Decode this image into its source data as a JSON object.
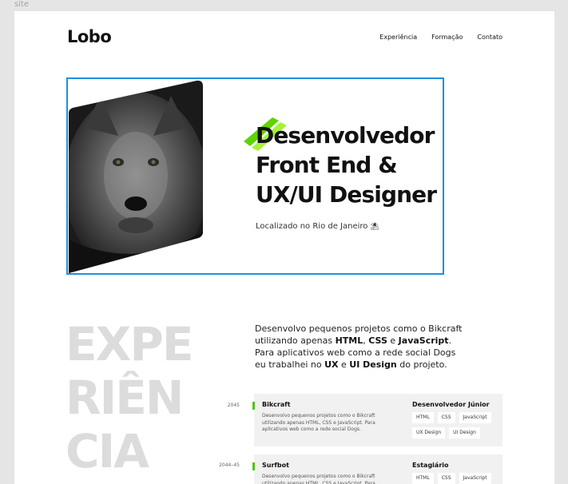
{
  "canvas": {
    "label": "site"
  },
  "header": {
    "logo": "Lobo",
    "nav": [
      "Experiência",
      "Formação",
      "Contato"
    ]
  },
  "hero": {
    "title_lines": [
      "Desenvolvedor",
      "Front End &",
      "UX/UI Designer"
    ],
    "location": "Localizado no Rio de Janeiro",
    "location_icon": "beach-umbrella-icon",
    "accent_color": "#6dd400",
    "selection_color": "#1f8fe0"
  },
  "experience": {
    "heading_lines": [
      "EXPE",
      "RIÊN",
      "CIA"
    ],
    "intro": {
      "p1": "Desenvolvo pequenos projetos como o Bikcraft utilizando apenas ",
      "html": "HTML",
      "sep1": ", ",
      "css": "CSS",
      "sep2": " e ",
      "js": "JavaScript",
      "p2": ". Para aplicativos web como a rede social Dogs eu trabalhei no ",
      "ux": "UX",
      "sep3": " e ",
      "uidesign": "UI Design",
      "p3": " do projeto."
    },
    "jobs": [
      {
        "year": "2045",
        "company": "Bikcraft",
        "description": "Desenvolvo pequenos projetos como o Bikcraft utilizando apenas HTML, CSS e JavaScript. Para aplicativos web como a rede social Dogs.",
        "role": "Desenvolvedor Júnior",
        "tags": [
          "HTML",
          "CSS",
          "JavaScript",
          "UX Design",
          "UI Design"
        ]
      },
      {
        "year": "2044–45",
        "company": "Surfbot",
        "description": "Desenvolvo pequenos projetos como o Bikcraft utilizando apenas HTML, CSS e JavaScript. Para aplicativos web como a rede social Dogs.",
        "role": "Estagiário",
        "tags": [
          "HTML",
          "CSS",
          "JavaScript"
        ]
      }
    ]
  }
}
